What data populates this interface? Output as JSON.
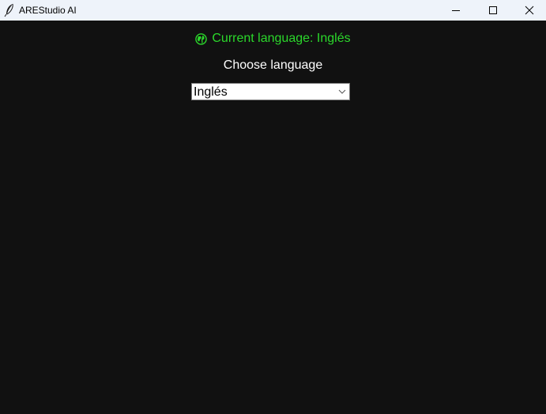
{
  "window": {
    "title": "AREStudio AI",
    "icon": "feather-icon",
    "controls": [
      "minimize-icon",
      "maximize-icon",
      "close-icon"
    ]
  },
  "main": {
    "current_language_text": "Current language: Inglés",
    "current_language_icon": "globe-icon",
    "choose_label": "Choose language",
    "language_select": {
      "selected": "Inglés"
    }
  },
  "colors": {
    "background": "#111111",
    "titlebar": "#eef3fa",
    "accent_green": "#2bd82b",
    "label_white": "#ffffff"
  }
}
